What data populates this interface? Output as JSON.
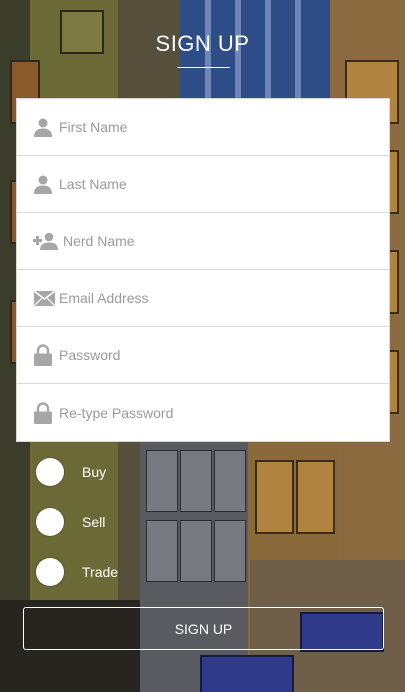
{
  "header": {
    "title": "SIGN UP"
  },
  "form": {
    "fields": [
      {
        "icon": "user-icon",
        "placeholder": "First Name",
        "value": ""
      },
      {
        "icon": "user-icon",
        "placeholder": "Last Name",
        "value": ""
      },
      {
        "icon": "add-user-icon",
        "placeholder": "Nerd Name",
        "value": ""
      },
      {
        "icon": "envelope-icon",
        "placeholder": "Email Address",
        "value": ""
      },
      {
        "icon": "lock-icon",
        "placeholder": "Password",
        "value": ""
      },
      {
        "icon": "lock-icon",
        "placeholder": "Re-type Password",
        "value": ""
      }
    ]
  },
  "options": [
    {
      "label": "Buy",
      "selected": false
    },
    {
      "label": "Sell",
      "selected": false
    },
    {
      "label": "Trade",
      "selected": false
    }
  ],
  "submit": {
    "label": "SIGN UP"
  },
  "colors": {
    "text_on_bg": "#ffffff",
    "placeholder": "#9a9a9a",
    "icon": "#a6a6a6",
    "field_bg": "#ffffff"
  }
}
